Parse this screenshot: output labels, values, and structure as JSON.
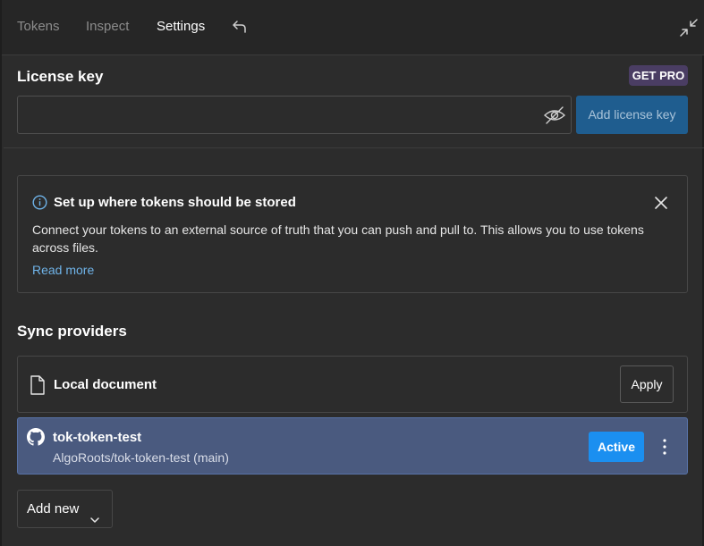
{
  "tabs": [
    {
      "label": "Tokens",
      "active": false
    },
    {
      "label": "Inspect",
      "active": false
    },
    {
      "label": "Settings",
      "active": true
    }
  ],
  "icons": {
    "undo": "undo-icon",
    "collapse": "collapse-icon",
    "eye": "eye-off-icon",
    "info": "info-icon",
    "close": "close-icon",
    "document": "document-icon",
    "github": "github-icon",
    "more": "more-vertical-icon",
    "chevron": "chevron-down-icon"
  },
  "license": {
    "title": "License key",
    "get_pro": "GET PRO",
    "input_value": "",
    "add_button": "Add license key"
  },
  "info_box": {
    "title": "Set up where tokens should be stored",
    "body": "Connect your tokens to an external source of truth that you can push and pull to. This allows you to use tokens across files.",
    "link": "Read more"
  },
  "sync": {
    "title": "Sync providers",
    "providers": [
      {
        "name": "Local document",
        "action": "Apply"
      },
      {
        "name": "tok-token-test",
        "repo": "AlgoRoots/tok-token-test (main)",
        "status": "Active"
      }
    ],
    "add_new": "Add new"
  },
  "colors": {
    "accent": "#1b8ff0",
    "active_row": "#4a5a7f",
    "link": "#6fb3e8",
    "pro_badge": "#4a3d63"
  }
}
